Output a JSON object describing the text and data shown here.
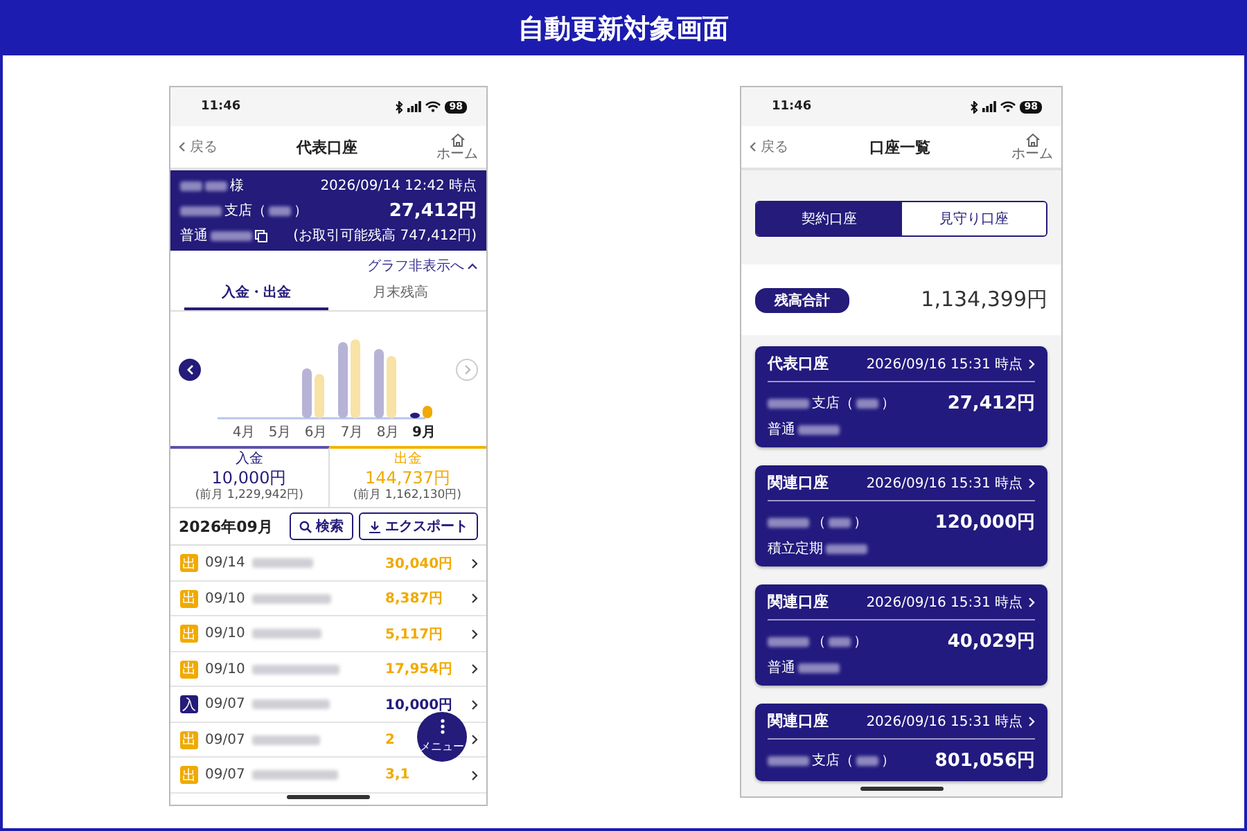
{
  "banner": {
    "title": "自動更新対象画面"
  },
  "detail_screen": {
    "status_bar": {
      "time": "11:46",
      "battery": "98"
    },
    "nav": {
      "back": "戻る",
      "title": "代表口座",
      "home": "ホーム"
    },
    "account": {
      "name_parts": [
        {
          "kind": "blur_short"
        },
        {
          "kind": "blur_short"
        },
        {
          "kind": "text",
          "text": "様"
        }
      ],
      "date": "2026/09/14 12:42 時点",
      "branch_parts": [
        {
          "kind": "blur"
        },
        {
          "kind": "text",
          "text": "支店（"
        },
        {
          "kind": "blur_short"
        },
        {
          "kind": "text",
          "text": "）"
        }
      ],
      "balance": "27,412円",
      "number_parts": [
        {
          "kind": "text",
          "text": "普通"
        },
        {
          "kind": "blur"
        }
      ],
      "available": "(お取引可能残高 747,412円)"
    },
    "graph_toggle": "グラフ非表示へ",
    "tabs": [
      {
        "label": "入金・出金",
        "selected": true
      },
      {
        "label": "月末残高",
        "selected": false
      }
    ],
    "chart": {
      "months": [
        {
          "label": "4月",
          "selected": false
        },
        {
          "label": "5月",
          "selected": false
        },
        {
          "label": "6月",
          "selected": false
        },
        {
          "label": "7月",
          "selected": false
        },
        {
          "label": "8月",
          "selected": false
        },
        {
          "label": "9月",
          "selected": true
        }
      ]
    },
    "summary": [
      {
        "kind": "in",
        "label": "入金",
        "amount": "10,000円",
        "previous": "(前月 1,229,942円)"
      },
      {
        "kind": "out",
        "label": "出金",
        "amount": "144,737円",
        "previous": "(前月 1,162,130円)"
      }
    ],
    "month_heading": "2026年09月",
    "buttons": [
      {
        "kind": "search",
        "label": "検索"
      },
      {
        "kind": "export",
        "label": "エクスポート"
      }
    ],
    "transactions": [
      {
        "kind": "out",
        "badge": "出",
        "date": "09/14",
        "amount": "30,040円"
      },
      {
        "kind": "out",
        "badge": "出",
        "date": "09/10",
        "amount": "8,387円"
      },
      {
        "kind": "out",
        "badge": "出",
        "date": "09/10",
        "amount": "5,117円"
      },
      {
        "kind": "out",
        "badge": "出",
        "date": "09/10",
        "amount": "17,954円"
      },
      {
        "kind": "in",
        "badge": "入",
        "date": "09/07",
        "amount": "10,000円"
      },
      {
        "kind": "out",
        "badge": "出",
        "date": "09/07",
        "amount": "2"
      },
      {
        "kind": "out",
        "badge": "出",
        "date": "09/07",
        "amount": "3,1"
      }
    ],
    "menu_button": {
      "label": "メニュー"
    }
  },
  "list_screen": {
    "status_bar": {
      "time": "11:46",
      "battery": "98"
    },
    "nav": {
      "back": "戻る",
      "title": "口座一覧",
      "home": "ホーム"
    },
    "segments": [
      {
        "label": "契約口座",
        "selected": true
      },
      {
        "label": "見守り口座",
        "selected": false
      }
    ],
    "total": {
      "badge": "残高合計",
      "amount": "1,134,399円"
    },
    "accounts": [
      {
        "title": "代表口座",
        "date": "2026/09/16 15:31 時点",
        "branch_parts": [
          {
            "kind": "blur"
          },
          {
            "kind": "text",
            "text": "支店（"
          },
          {
            "kind": "blur_short"
          },
          {
            "kind": "text",
            "text": "）"
          }
        ],
        "balance": "27,412円",
        "type_parts": [
          {
            "kind": "text",
            "text": "普通"
          },
          {
            "kind": "blur"
          }
        ]
      },
      {
        "title": "関連口座",
        "date": "2026/09/16 15:31 時点",
        "branch_parts": [
          {
            "kind": "blur"
          },
          {
            "kind": "text",
            "text": "（"
          },
          {
            "kind": "blur_short"
          },
          {
            "kind": "text",
            "text": "）"
          }
        ],
        "balance": "120,000円",
        "type_parts": [
          {
            "kind": "text",
            "text": "積立定期"
          },
          {
            "kind": "blur"
          }
        ]
      },
      {
        "title": "関連口座",
        "date": "2026/09/16 15:31 時点",
        "branch_parts": [
          {
            "kind": "blur"
          },
          {
            "kind": "text",
            "text": "（"
          },
          {
            "kind": "blur_short"
          },
          {
            "kind": "text",
            "text": "）"
          }
        ],
        "balance": "40,029円",
        "type_parts": [
          {
            "kind": "text",
            "text": "普通"
          },
          {
            "kind": "blur"
          }
        ]
      },
      {
        "title": "関連口座",
        "date": "2026/09/16 15:31 時点",
        "branch_parts": [
          {
            "kind": "blur"
          },
          {
            "kind": "text",
            "text": "支店（"
          },
          {
            "kind": "blur_short"
          },
          {
            "kind": "text",
            "text": "）"
          }
        ],
        "balance": "801,056円"
      }
    ]
  }
}
